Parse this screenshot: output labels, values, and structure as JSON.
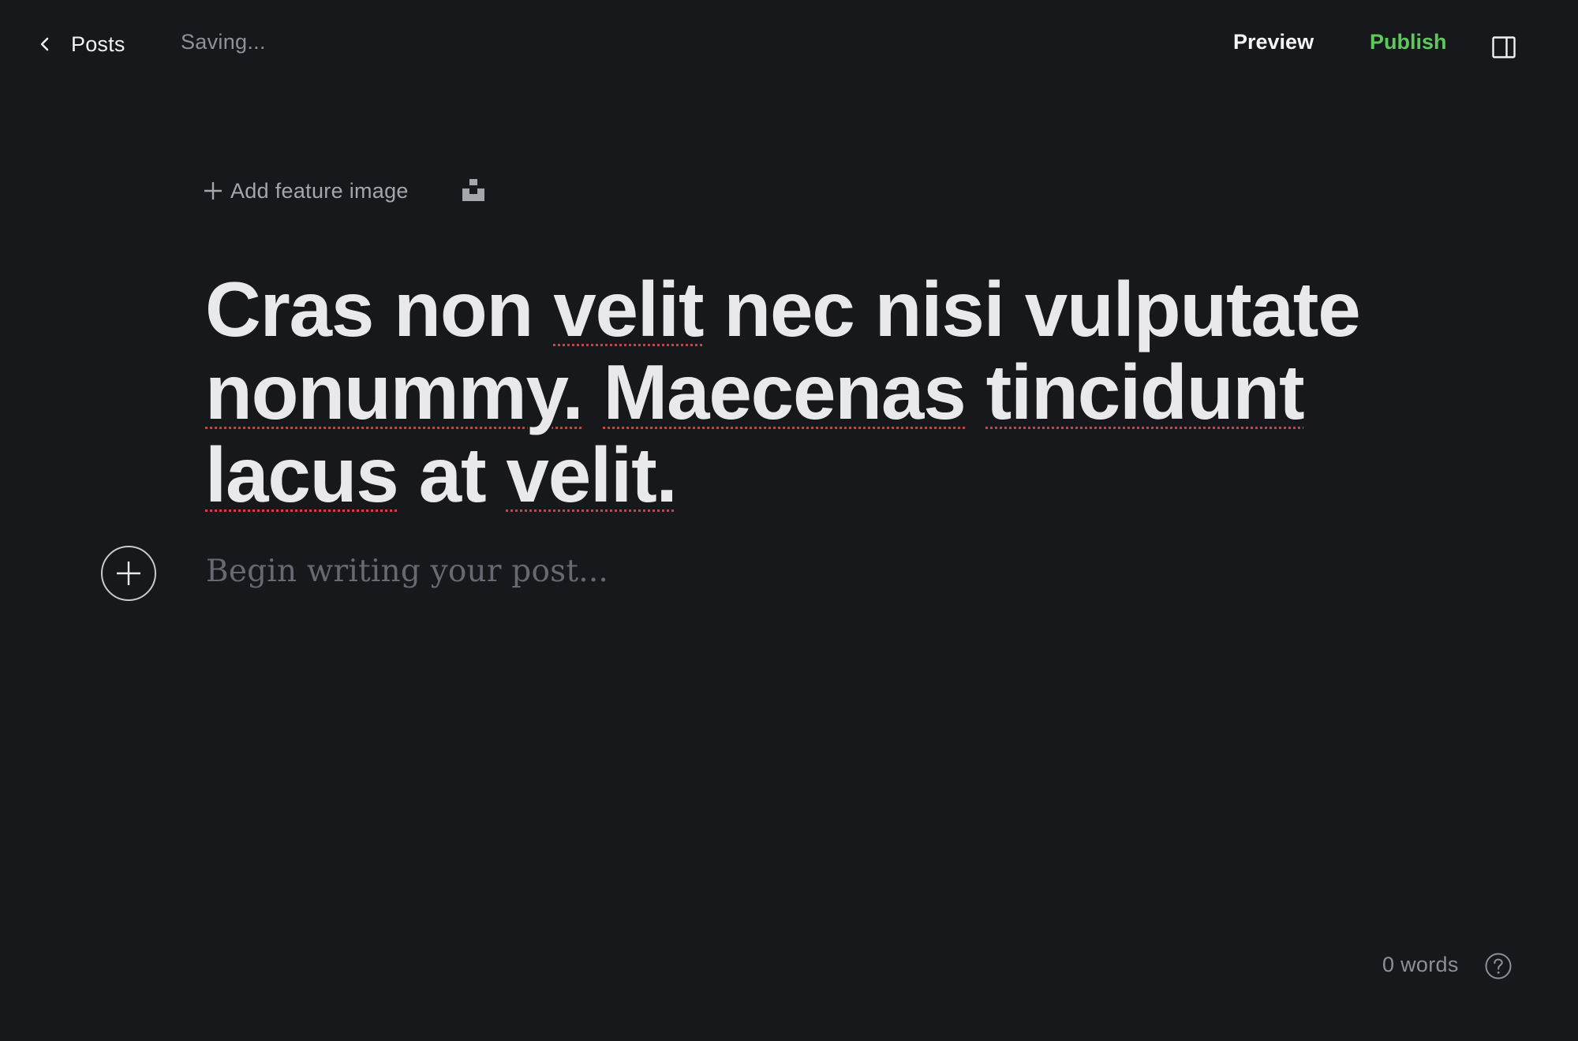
{
  "app": {
    "accent_color": "#5bc95b",
    "background_color": "#17181c"
  },
  "topbar": {
    "back_label": "Posts",
    "back_icon": "chevron-left-icon",
    "save_status": "Saving...",
    "preview_label": "Preview",
    "publish_label": "Publish",
    "sidebar_icon": "sidebar-panel-icon"
  },
  "editor": {
    "feature_image_label": "Add feature image",
    "feature_image_icon": "plus-icon",
    "unsplash_icon": "unsplash-icon",
    "title_words": [
      {
        "text": "Cras",
        "misspelled": false
      },
      {
        "text": "non",
        "misspelled": false
      },
      {
        "text": "velit",
        "misspelled": true
      },
      {
        "text": "nec",
        "misspelled": false
      },
      {
        "text": "nisi",
        "misspelled": false
      },
      {
        "text": "vulputate",
        "misspelled": false
      },
      {
        "text": "nonummy.",
        "misspelled": true
      },
      {
        "text": "Maecenas",
        "misspelled": true
      },
      {
        "text": "tincidunt",
        "misspelled": true
      },
      {
        "text": "lacus",
        "misspelled": true
      },
      {
        "text": "at",
        "misspelled": false
      },
      {
        "text": "velit.",
        "misspelled": true
      }
    ],
    "body_placeholder": "Begin writing your post...",
    "add_card_icon": "plus-circle-icon"
  },
  "footer": {
    "word_count": "0 words",
    "help_icon": "question-circle-icon"
  }
}
